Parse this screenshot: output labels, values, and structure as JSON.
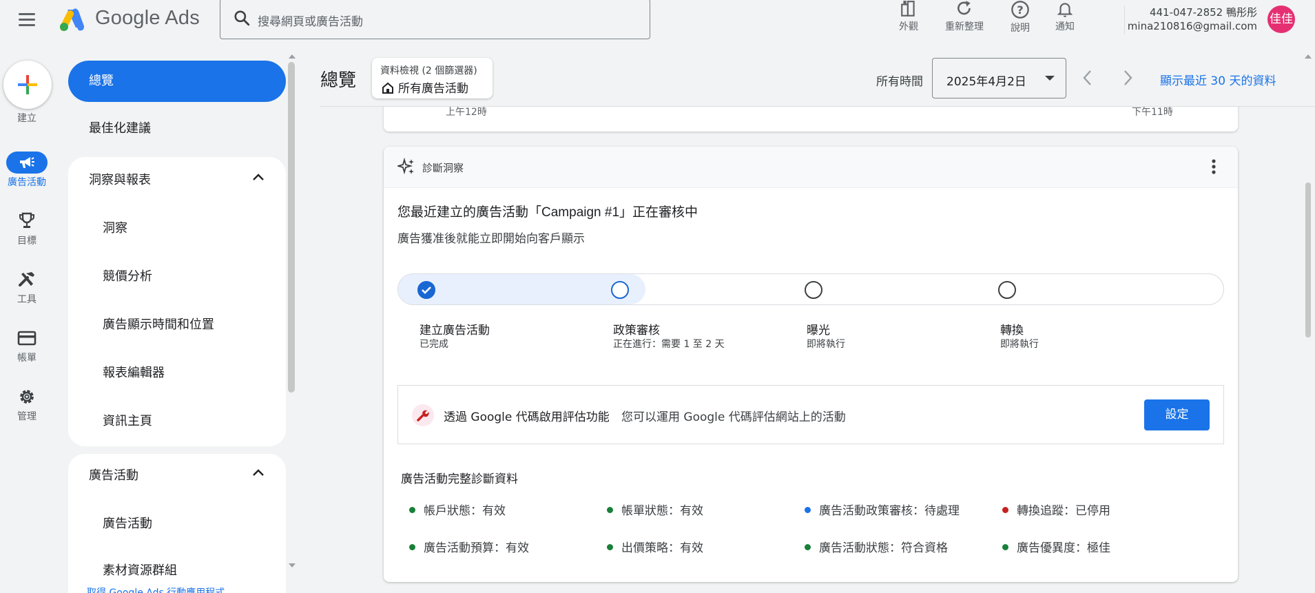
{
  "header": {
    "brand": "Google Ads",
    "search_placeholder": "搜尋網頁或廣告活動",
    "actions": [
      {
        "label": "外觀",
        "icon": "appearance-icon"
      },
      {
        "label": "重新整理",
        "icon": "refresh-icon"
      },
      {
        "label": "說明",
        "icon": "help-icon"
      },
      {
        "label": "通知",
        "icon": "bell-icon"
      }
    ],
    "account_line1": "441-047-2852 鴨彤彤",
    "account_line2": "mina210816@gmail.com",
    "avatar_text": "佳佳"
  },
  "rail": {
    "create_label": "建立",
    "items": [
      {
        "label": "廣告活動",
        "icon": "megaphone-icon",
        "active": true
      },
      {
        "label": "目標",
        "icon": "trophy-icon"
      },
      {
        "label": "工具",
        "icon": "tools-icon"
      },
      {
        "label": "帳單",
        "icon": "credit-card-icon"
      },
      {
        "label": "管理",
        "icon": "gear-icon"
      }
    ]
  },
  "sidebar": {
    "overview": "總覽",
    "recommendations": "最佳化建議",
    "insights_group": {
      "title": "洞察與報表",
      "items": [
        "洞察",
        "競價分析",
        "廣告顯示時間和位置",
        "報表編輯器",
        "資訊主頁"
      ]
    },
    "campaigns_group": {
      "title": "廣告活動",
      "items": [
        "廣告活動",
        "素材資源群組"
      ]
    },
    "cut_link": "取得 Google Ads 行動應用程式"
  },
  "topbar": {
    "page_title": "總覽",
    "view_chip_line1": "資料檢視 (2 個篩選器)",
    "view_chip_line2": "所有廣告活動",
    "time_label": "所有時間",
    "date_value": "2025年4月2日",
    "last30_prefix": "顯示最近 ",
    "last30_num": "30",
    "last30_suffix": " 天的資料"
  },
  "chart_card": {
    "tick_left": "上午12時",
    "tick_right": "下午11時"
  },
  "diagnostics": {
    "card_title": "診斷洞察",
    "message_title_prefix": "您最近建立的廣告活動「",
    "message_title_campaign": "Campaign #1",
    "message_title_suffix": "」正在審核中",
    "message_sub": "廣告獲准後就能立即開始向客戶顯示",
    "progress_fraction": 0.3,
    "steps": [
      {
        "label": "建立廣告活動",
        "status": "已完成",
        "state": "done"
      },
      {
        "label": "政策審核",
        "status": "正在進行：需要 1 至 2 天",
        "state": "current"
      },
      {
        "label": "曝光",
        "status": "即將執行",
        "state": "pending"
      },
      {
        "label": "轉換",
        "status": "即將執行",
        "state": "pending"
      }
    ],
    "promo_title": "透過 Google 代碼啟用評估功能",
    "promo_desc": "您可以運用 Google 代碼評估網站上的活動",
    "promo_button": "設定",
    "full_title": "廣告活動完整診斷資料",
    "status_items": [
      {
        "text": "帳戶狀態：有效",
        "color": "#188038"
      },
      {
        "text": "帳單狀態：有效",
        "color": "#188038"
      },
      {
        "text": "廣告活動政策審核：待處理",
        "color": "#1a73e8"
      },
      {
        "text": "轉換追蹤：已停用",
        "color": "#c5221f"
      },
      {
        "text": "廣告活動預算：有效",
        "color": "#188038"
      },
      {
        "text": "出價策略：有效",
        "color": "#188038"
      },
      {
        "text": "廣告活動狀態：符合資格",
        "color": "#188038"
      },
      {
        "text": "廣告優異度：極佳",
        "color": "#188038"
      }
    ]
  },
  "colors": {
    "accent": "#1a73e8",
    "background": "#f1f3f4",
    "avatar": "#e52f72"
  }
}
